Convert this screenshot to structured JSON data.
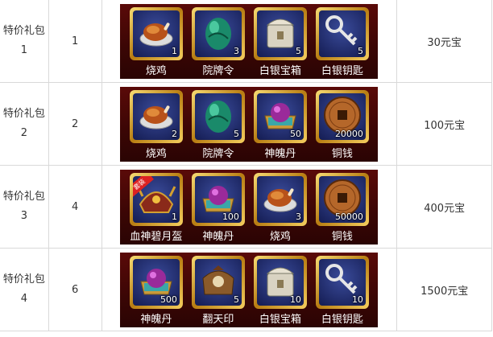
{
  "rows": [
    {
      "name": "特价礼包1",
      "count": "1",
      "price": "30元宝",
      "items": [
        {
          "label": "烧鸡",
          "qty": "1",
          "icon": "roast-chicken"
        },
        {
          "label": "院牌令",
          "qty": "3",
          "icon": "green-jade"
        },
        {
          "label": "白银宝箱",
          "qty": "5",
          "icon": "silver-chest"
        },
        {
          "label": "白银钥匙",
          "qty": "5",
          "icon": "silver-key"
        }
      ]
    },
    {
      "name": "特价礼包2",
      "count": "2",
      "price": "100元宝",
      "items": [
        {
          "label": "烧鸡",
          "qty": "2",
          "icon": "roast-chicken"
        },
        {
          "label": "院牌令",
          "qty": "5",
          "icon": "green-jade"
        },
        {
          "label": "神魄丹",
          "qty": "50",
          "icon": "purple-pill-box"
        },
        {
          "label": "铜钱",
          "qty": "20000",
          "icon": "copper-coin"
        }
      ]
    },
    {
      "name": "特价礼包3",
      "count": "4",
      "price": "400元宝",
      "items": [
        {
          "label": "血神碧月盔",
          "qty": "1",
          "icon": "helmet",
          "badge": "套装"
        },
        {
          "label": "神魄丹",
          "qty": "100",
          "icon": "purple-pill-box"
        },
        {
          "label": "烧鸡",
          "qty": "3",
          "icon": "roast-chicken"
        },
        {
          "label": "铜钱",
          "qty": "50000",
          "icon": "copper-coin"
        }
      ]
    },
    {
      "name": "特价礼包4",
      "count": "6",
      "price": "1500元宝",
      "items": [
        {
          "label": "神魄丹",
          "qty": "500",
          "icon": "purple-pill-box"
        },
        {
          "label": "翻天印",
          "qty": "5",
          "icon": "seal"
        },
        {
          "label": "白银宝箱",
          "qty": "10",
          "icon": "silver-chest"
        },
        {
          "label": "白银钥匙",
          "qty": "10",
          "icon": "silver-key"
        }
      ]
    }
  ]
}
